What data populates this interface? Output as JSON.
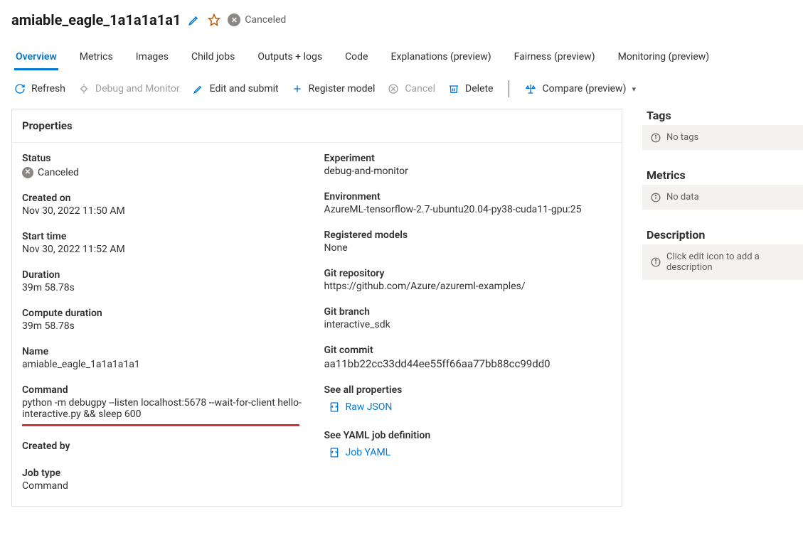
{
  "header": {
    "title": "amiable_eagle_1a1a1a1a1",
    "status_label": "Canceled"
  },
  "tabs": [
    {
      "label": "Overview",
      "active": true
    },
    {
      "label": "Metrics",
      "active": false
    },
    {
      "label": "Images",
      "active": false
    },
    {
      "label": "Child jobs",
      "active": false
    },
    {
      "label": "Outputs + logs",
      "active": false
    },
    {
      "label": "Code",
      "active": false
    },
    {
      "label": "Explanations (preview)",
      "active": false
    },
    {
      "label": "Fairness (preview)",
      "active": false
    },
    {
      "label": "Monitoring (preview)",
      "active": false
    }
  ],
  "toolbar": {
    "refresh": "Refresh",
    "debug": "Debug and Monitor",
    "edit": "Edit and submit",
    "register": "Register model",
    "cancel": "Cancel",
    "delete": "Delete",
    "compare": "Compare (preview)"
  },
  "panel_title": "Properties",
  "left_fields": {
    "status_label": "Status",
    "status_value": "Canceled",
    "created_on_label": "Created on",
    "created_on_value": "Nov 30, 2022 11:50 AM",
    "start_time_label": "Start time",
    "start_time_value": "Nov 30, 2022 11:52 AM",
    "duration_label": "Duration",
    "duration_value": "39m 58.78s",
    "compute_duration_label": "Compute duration",
    "compute_duration_value": "39m 58.78s",
    "name_label": "Name",
    "name_value": "amiable_eagle_1a1a1a1a1",
    "command_label": "Command",
    "command_value": "python -m debugpy --listen localhost:5678 --wait-for-client hello-interactive.py && sleep 600",
    "created_by_label": "Created by",
    "created_by_value": "",
    "job_type_label": "Job type",
    "job_type_value": "Command"
  },
  "right_fields": {
    "experiment_label": "Experiment",
    "experiment_value": "debug-and-monitor",
    "environment_label": "Environment",
    "environment_value": "AzureML-tensorflow-2.7-ubuntu20.04-py38-cuda11-gpu:25",
    "registered_models_label": "Registered models",
    "registered_models_value": "None",
    "git_repo_label": "Git repository",
    "git_repo_value": "https://github.com/Azure/azureml-examples/",
    "git_branch_label": "Git branch",
    "git_branch_value": "interactive_sdk",
    "git_commit_label": "Git commit",
    "git_commit_value": "aa11bb22cc33dd44ee55ff66aa77bb88cc99dd0",
    "see_all_props_label": "See all properties",
    "raw_json": "Raw JSON",
    "see_yaml_label": "See YAML job definition",
    "job_yaml": "Job YAML"
  },
  "sidebar": {
    "tags_header": "Tags",
    "tags_empty": "No tags",
    "metrics_header": "Metrics",
    "metrics_empty": "No data",
    "description_header": "Description",
    "description_empty": "Click edit icon to add a description"
  }
}
